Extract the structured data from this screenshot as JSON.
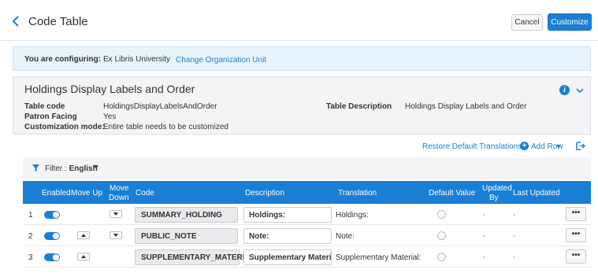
{
  "header": {
    "title": "Code Table",
    "cancel_label": "Cancel",
    "customize_label": "Customize"
  },
  "config": {
    "label": "You are configuring:",
    "value": "Ex Libris University",
    "change_link": "Change Organization Unit"
  },
  "details": {
    "title": "Holdings Display Labels and Order",
    "table_code_label": "Table code",
    "table_code_value": "HoldingsDisplayLabelsAndOrder",
    "patron_facing_label": "Patron Facing",
    "patron_facing_value": "Yes",
    "customization_label": "Customization mode:",
    "customization_value": "Entire table needs to be customized",
    "description_label": "Table Description",
    "description_value": "Holdings Display Labels and Order"
  },
  "toolbar": {
    "restore_label": "Restore Default Translations",
    "add_row_label": "Add Row"
  },
  "filter": {
    "label": "Filter :",
    "value": "English"
  },
  "table": {
    "headers": {
      "enabled": "Enabled",
      "move_up": "Move Up",
      "move_down_1": "Move",
      "move_down_2": "Down",
      "code": "Code",
      "description": "Description",
      "translation": "Translation",
      "default_value": "Default Value",
      "updated_by_1": "Updated",
      "updated_by_2": "By",
      "last_updated": "Last Updated"
    },
    "rows": [
      {
        "num": "1",
        "code": "SUMMARY_HOLDING",
        "description": "Holdings:",
        "translation": "Holdings:",
        "updated_by": "-",
        "last_updated": "-",
        "more": "•••",
        "enabled": true
      },
      {
        "num": "2",
        "code": "PUBLIC_NOTE",
        "description": "Note:",
        "translation": "Note:",
        "updated_by": "-",
        "last_updated": "-",
        "more": "•••",
        "enabled": true
      },
      {
        "num": "3",
        "code": "SUPPLEMENTARY_MATERIAL",
        "description": "Supplementary Material:",
        "translation": "Supplementary Material:",
        "updated_by": "-",
        "last_updated": "-",
        "more": "•••",
        "enabled": true
      }
    ]
  },
  "colors": {
    "accent": "#1a7fd4",
    "config_bg": "#e8f4fb",
    "panel_bg": "#f3f4f5"
  }
}
